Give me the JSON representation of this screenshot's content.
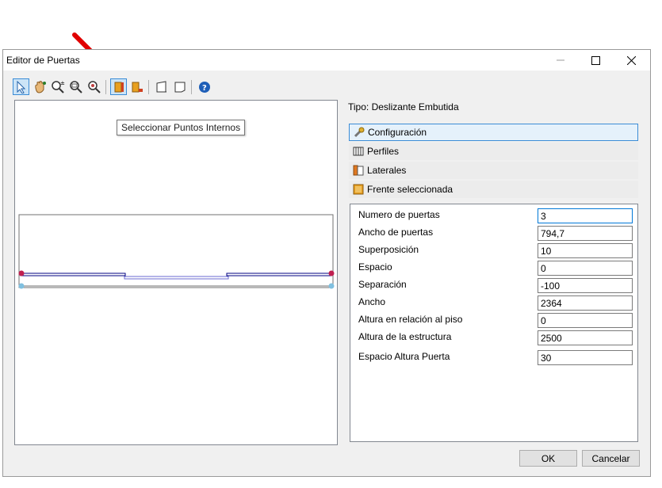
{
  "window": {
    "title": "Editor de Puertas",
    "minimize_icon": "minimize-icon",
    "maximize_icon": "maximize-icon",
    "close_icon": "close-icon"
  },
  "toolbar": {
    "tools": [
      "select-arrow-icon",
      "pan-hand-icon",
      "zoom-extents-icon",
      "zoom-window-icon",
      "zoom-icon",
      "select-internal-points-icon",
      "select-external-points-icon",
      "front-view-icon",
      "side-view-icon",
      "help-icon"
    ],
    "active_tool": "select-internal-points-icon"
  },
  "tooltip": "Seleccionar Puntos Internos",
  "tipo_label": "Tipo: Deslizante Embutida",
  "sections": [
    {
      "label": "Configuración",
      "icon": "wrench-icon"
    },
    {
      "label": "Perfiles",
      "icon": "profiles-icon"
    },
    {
      "label": "Laterales",
      "icon": "laterals-icon"
    },
    {
      "label": "Frente seleccionada",
      "icon": "front-panel-icon"
    }
  ],
  "properties": [
    {
      "label": "Numero de puertas",
      "value": "3"
    },
    {
      "label": "Ancho de puertas",
      "value": "794,7"
    },
    {
      "label": "Superposición",
      "value": "10"
    },
    {
      "label": "Espacio",
      "value": "0"
    },
    {
      "label": "Separación",
      "value": "-100"
    },
    {
      "label": "Ancho",
      "value": "2364"
    },
    {
      "label": "Altura en relación al piso",
      "value": "0"
    },
    {
      "label": "Altura de la estructura",
      "value": "2500"
    },
    {
      "label": "Espacio Altura Puerta",
      "value": "30"
    }
  ],
  "buttons": {
    "ok": "OK",
    "cancel": "Cancelar"
  },
  "colors": {
    "accent": "#0078d7",
    "annotation_arrow": "#e00000",
    "door_outline": "#000080"
  }
}
